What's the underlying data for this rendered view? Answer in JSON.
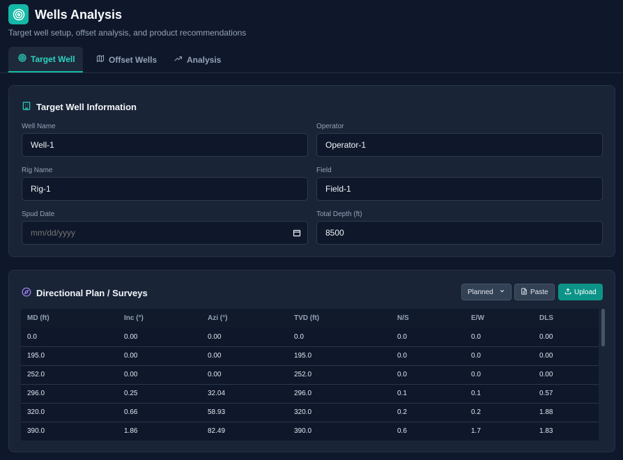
{
  "app": {
    "title": "Wells Analysis",
    "subtitle": "Target well setup, offset analysis, and product recommendations",
    "logo_icon": "target-icon"
  },
  "tabs": [
    {
      "label": "Target Well",
      "icon": "target-icon",
      "active": true
    },
    {
      "label": "Offset Wells",
      "icon": "map-icon",
      "active": false
    },
    {
      "label": "Analysis",
      "icon": "trending-up-icon",
      "active": false
    }
  ],
  "target_well": {
    "title": "Target Well Information",
    "icon": "building-icon",
    "fields": {
      "well_name": {
        "label": "Well Name",
        "value": "Well-1"
      },
      "operator": {
        "label": "Operator",
        "value": "Operator-1"
      },
      "rig_name": {
        "label": "Rig Name",
        "value": "Rig-1"
      },
      "field": {
        "label": "Field",
        "value": "Field-1"
      },
      "spud_date": {
        "label": "Spud Date",
        "value": "",
        "placeholder": "mm/dd/yyyy"
      },
      "total_depth": {
        "label": "Total Depth (ft)",
        "value": "8500"
      }
    }
  },
  "directional": {
    "title": "Directional Plan / Surveys",
    "icon": "compass-icon",
    "mode_select": {
      "selected": "Planned"
    },
    "paste_label": "Paste",
    "upload_label": "Upload",
    "columns": [
      "MD (ft)",
      "Inc (°)",
      "Azi (°)",
      "TVD (ft)",
      "N/S",
      "E/W",
      "DLS"
    ],
    "rows": [
      [
        "0.0",
        "0.00",
        "0.00",
        "0.0",
        "0.0",
        "0.0",
        "0.00"
      ],
      [
        "195.0",
        "0.00",
        "0.00",
        "195.0",
        "0.0",
        "0.0",
        "0.00"
      ],
      [
        "252.0",
        "0.00",
        "0.00",
        "252.0",
        "0.0",
        "0.0",
        "0.00"
      ],
      [
        "296.0",
        "0.25",
        "32.04",
        "296.0",
        "0.1",
        "0.1",
        "0.57"
      ],
      [
        "320.0",
        "0.66",
        "58.93",
        "320.0",
        "0.2",
        "0.2",
        "1.88"
      ],
      [
        "390.0",
        "1.86",
        "82.49",
        "390.0",
        "0.6",
        "1.7",
        "1.83"
      ]
    ]
  },
  "colors": {
    "accent": "#14b8a6",
    "background": "#0f172a",
    "card": "#1a2437"
  }
}
